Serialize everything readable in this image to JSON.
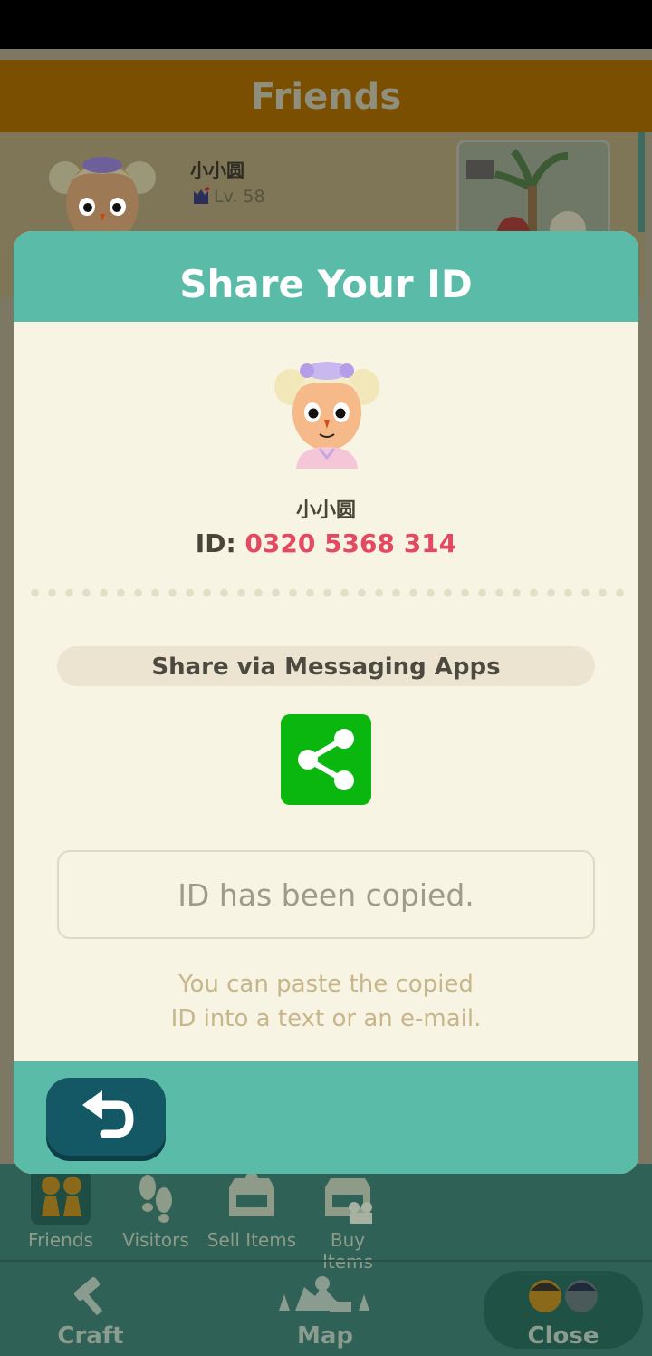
{
  "background": {
    "header_title": "Friends",
    "friend": {
      "name": "小小圆",
      "level": "Lv. 58"
    },
    "bottom_nav": {
      "row1": [
        {
          "label": "Friends",
          "icon": "friends-icon",
          "active": true
        },
        {
          "label": "Visitors",
          "icon": "footprints-icon",
          "active": false
        },
        {
          "label": "Sell Items",
          "icon": "sell-box-icon",
          "active": false
        },
        {
          "label": "Buy Items",
          "icon": "buy-box-icon",
          "active": false
        }
      ],
      "row2": [
        {
          "label": "Craft",
          "icon": "craft-hammer-icon"
        },
        {
          "label": "Map",
          "icon": "map-icon"
        },
        {
          "label": "Close",
          "icon": "close-characters-icon"
        }
      ]
    }
  },
  "modal": {
    "title": "Share Your ID",
    "player_name": "小小圆",
    "id_label": "ID:",
    "id_value": "0320 5368 314",
    "share_label": "Share via Messaging Apps",
    "share_icon": "share-icon",
    "copied_message": "ID has been copied.",
    "hint_line1": "You can paste the copied",
    "hint_line2": "ID into a text or an e-mail.",
    "back_icon": "back-arrow-icon"
  },
  "colors": {
    "modal_teal": "#5abca8",
    "modal_bg": "#f8f4e3",
    "id_pink": "#e34a62",
    "share_green": "#0ab70f",
    "back_button": "#135864"
  }
}
